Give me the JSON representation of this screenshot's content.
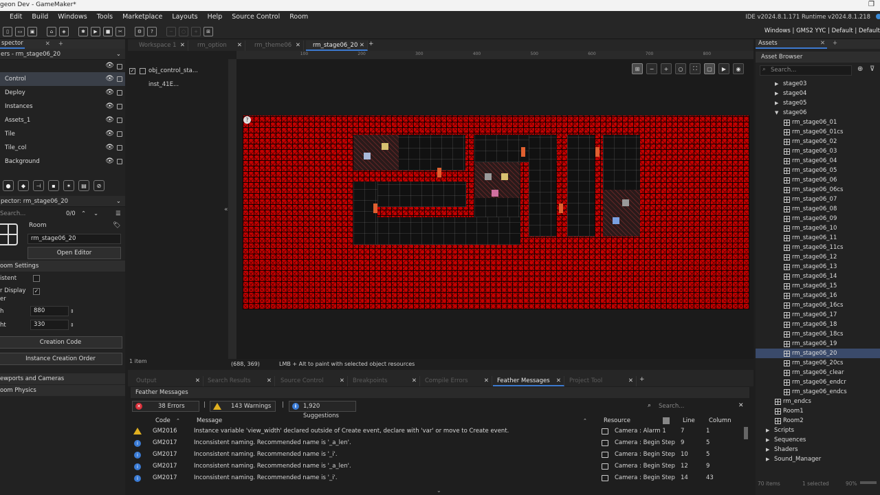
{
  "app": {
    "title": "geon Dev - GameMaker*",
    "version": "IDE v2024.8.1.171  Runtime v2024.8.1.218",
    "targets": "Windows | GMS2 YYC | Default | Default"
  },
  "menu": [
    "Edit",
    "Build",
    "Windows",
    "Tools",
    "Marketplace",
    "Layouts",
    "Help",
    "Source Control",
    "Room"
  ],
  "layers_panel": {
    "tab": "spector",
    "header": "ers - rm_stage06_20",
    "layers": [
      "Control",
      "Deploy",
      "Instances",
      "Assets_1",
      "Tile",
      "Tile_col",
      "Background"
    ]
  },
  "instances": {
    "row": "obj_control_sta...  inst_41E...",
    "count": "1 item"
  },
  "inspector": {
    "header": "pector: rm_stage06_20",
    "search_placeholder": "Search...",
    "search_count": "0/0",
    "type": "Room",
    "room_name": "rm_stage06_20",
    "open_editor": "Open Editor",
    "room_settings": "oom Settings",
    "persistent": "istent",
    "clear_display": "r Display",
    "clear_display_2": "er",
    "width_label": "h",
    "width": "880",
    "height_label": "ht",
    "height": "330",
    "creation_code": "Creation Code",
    "creation_order": "Instance Creation Order",
    "viewports": "ewports and Cameras",
    "physics": "oom Physics"
  },
  "room_tabs": [
    {
      "label": "Workspace 1",
      "active": false
    },
    {
      "label": "rm_option",
      "active": false
    },
    {
      "label": "rm_theme06",
      "active": false
    },
    {
      "label": "rm_stage06_20",
      "active": true
    }
  ],
  "status": {
    "coords": "(688, 369)",
    "hint": "LMB + Alt to paint with selected object resources"
  },
  "bottom_tabs": [
    {
      "label": "Output",
      "active": false
    },
    {
      "label": "Search Results",
      "active": false
    },
    {
      "label": "Source Control",
      "active": false
    },
    {
      "label": "Breakpoints",
      "active": false
    },
    {
      "label": "Compile Errors",
      "active": false
    },
    {
      "label": "Feather Messages",
      "active": true
    },
    {
      "label": "Project Tool",
      "active": false
    }
  ],
  "feather": {
    "title": "Feather Messages",
    "errors": "38 Errors",
    "warnings": "143 Warnings",
    "suggestions": "1,920 Suggestions",
    "search_placeholder": "Search...",
    "columns": {
      "code": "Code",
      "message": "Message",
      "resource": "Resource",
      "line": "Line",
      "column": "Column"
    },
    "rows": [
      {
        "kind": "warning",
        "code": "GM2016",
        "message": "Instance variable 'view_width' declared outside of Create event, declare with 'var' or move to Create event.",
        "resource": "Camera : Alarm 1",
        "line": "7",
        "column": "1"
      },
      {
        "kind": "info",
        "code": "GM2017",
        "message": "Inconsistent naming. Recommended name is '_a_len'.",
        "resource": "Camera : Begin Step",
        "line": "9",
        "column": "5"
      },
      {
        "kind": "info",
        "code": "GM2017",
        "message": "Inconsistent naming. Recommended name is '_i'.",
        "resource": "Camera : Begin Step",
        "line": "10",
        "column": "5"
      },
      {
        "kind": "info",
        "code": "GM2017",
        "message": "Inconsistent naming. Recommended name is '_a_len'.",
        "resource": "Camera : Begin Step",
        "line": "12",
        "column": "9"
      },
      {
        "kind": "info",
        "code": "GM2017",
        "message": "Inconsistent naming. Recommended name is '_i'.",
        "resource": "Camera : Begin Step",
        "line": "14",
        "column": "43"
      }
    ]
  },
  "assets": {
    "tab": "Assets",
    "browser": "Asset Browser",
    "search_placeholder": "Search...",
    "folders_top": [
      "stage03",
      "stage04",
      "stage05",
      "stage06"
    ],
    "stage06_rooms": [
      "rm_stage06_01",
      "rm_stage06_01cs",
      "rm_stage06_02",
      "rm_stage06_03",
      "rm_stage06_04",
      "rm_stage06_05",
      "rm_stage06_06",
      "rm_stage06_06cs",
      "rm_stage06_07",
      "rm_stage06_08",
      "rm_stage06_09",
      "rm_stage06_10",
      "rm_stage06_11",
      "rm_stage06_11cs",
      "rm_stage06_12",
      "rm_stage06_13",
      "rm_stage06_14",
      "rm_stage06_15",
      "rm_stage06_16",
      "rm_stage06_16cs",
      "rm_stage06_17",
      "rm_stage06_18",
      "rm_stage06_18cs",
      "rm_stage06_19",
      "rm_stage06_20",
      "rm_stage06_20cs",
      "rm_stage06_clear",
      "rm_stage06_endcr",
      "rm_stage06_endcs"
    ],
    "selected": "rm_stage06_20",
    "other_rooms": [
      "rm_endcs",
      "Room1",
      "Room2"
    ],
    "groups": [
      "Scripts",
      "Sequences",
      "Shaders",
      "Sound_Manager"
    ],
    "footer_left": "70 items",
    "footer_mid": "1 selected",
    "footer_zoom": "90%"
  },
  "colors": {
    "accent": "#3d7ad0",
    "wall": "#c40000",
    "error": "#d9303a",
    "warning": "#e0b020",
    "info": "#3a7bd5"
  }
}
